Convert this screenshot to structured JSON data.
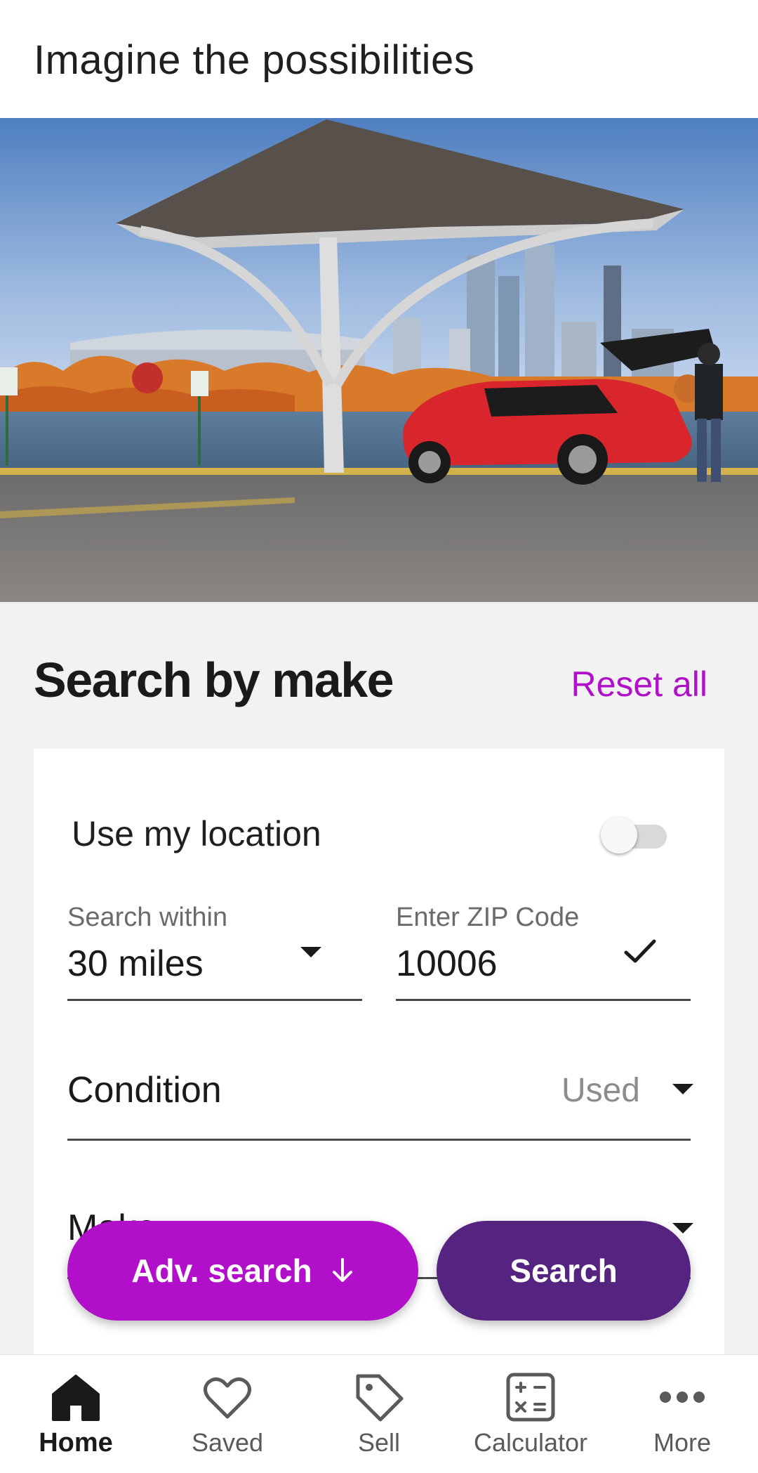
{
  "promo": {
    "title": "Imagine the possibilities"
  },
  "search_section": {
    "title": "Search by make",
    "reset_label": "Reset all"
  },
  "form": {
    "use_location_label": "Use my location",
    "use_location_enabled": false,
    "search_within_label": "Search within",
    "search_within_value": "30 miles",
    "zip_label": "Enter ZIP Code",
    "zip_value": "10006",
    "condition_label": "Condition",
    "condition_value": "Used",
    "make_label": "Make"
  },
  "buttons": {
    "adv_search_label": "Adv. search",
    "search_label": "Search"
  },
  "bottom_nav": {
    "items": [
      {
        "label": "Home",
        "icon": "home-icon",
        "active": true
      },
      {
        "label": "Saved",
        "icon": "heart-icon",
        "active": false
      },
      {
        "label": "Sell",
        "icon": "tag-icon",
        "active": false
      },
      {
        "label": "Calculator",
        "icon": "calculator-icon",
        "active": false
      },
      {
        "label": "More",
        "icon": "more-dots-icon",
        "active": false
      }
    ]
  },
  "colors": {
    "accent_magenta": "#b10fc9",
    "primary_purple": "#552380",
    "car_red": "#d8262c"
  }
}
